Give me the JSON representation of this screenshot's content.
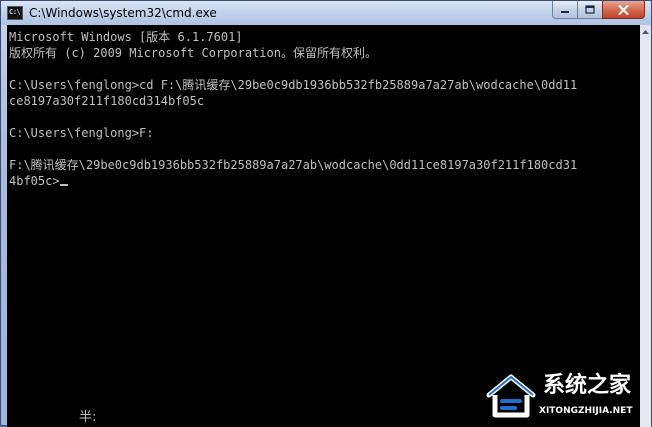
{
  "window": {
    "title": "C:\\Windows\\system32\\cmd.exe",
    "icon": "cmd-console-icon",
    "icon_glyph": "C:\\",
    "buttons": [
      "minimize-icon",
      "maximize-icon",
      "close-icon"
    ]
  },
  "console": {
    "lines": [
      "Microsoft Windows [版本 6.1.7601]",
      "版权所有 (c) 2009 Microsoft Corporation。保留所有权利。",
      "",
      "C:\\Users\\fenglong>cd F:\\腾讯缓存\\29be0c9db1936bb532fb25889a7a27ab\\wodcache\\0dd11",
      "ce8197a30f211f180cd314bf05c",
      "",
      "C:\\Users\\fenglong>F:",
      "",
      "F:\\腾讯缓存\\29be0c9db1936bb532fb25889a7a27ab\\wodcache\\0dd11ce8197a30f211f180cd31",
      "4bf05c>"
    ],
    "ime_indicator": "半:"
  },
  "watermark": {
    "name": "系统之家",
    "domain": "XITONGZHIJIA.NET",
    "logo": "house-logo-icon"
  },
  "colors": {
    "console_bg": "#000000",
    "console_fg": "#c0c0c0",
    "close_red": "#c0442c",
    "frame": "#a9bcdc"
  }
}
